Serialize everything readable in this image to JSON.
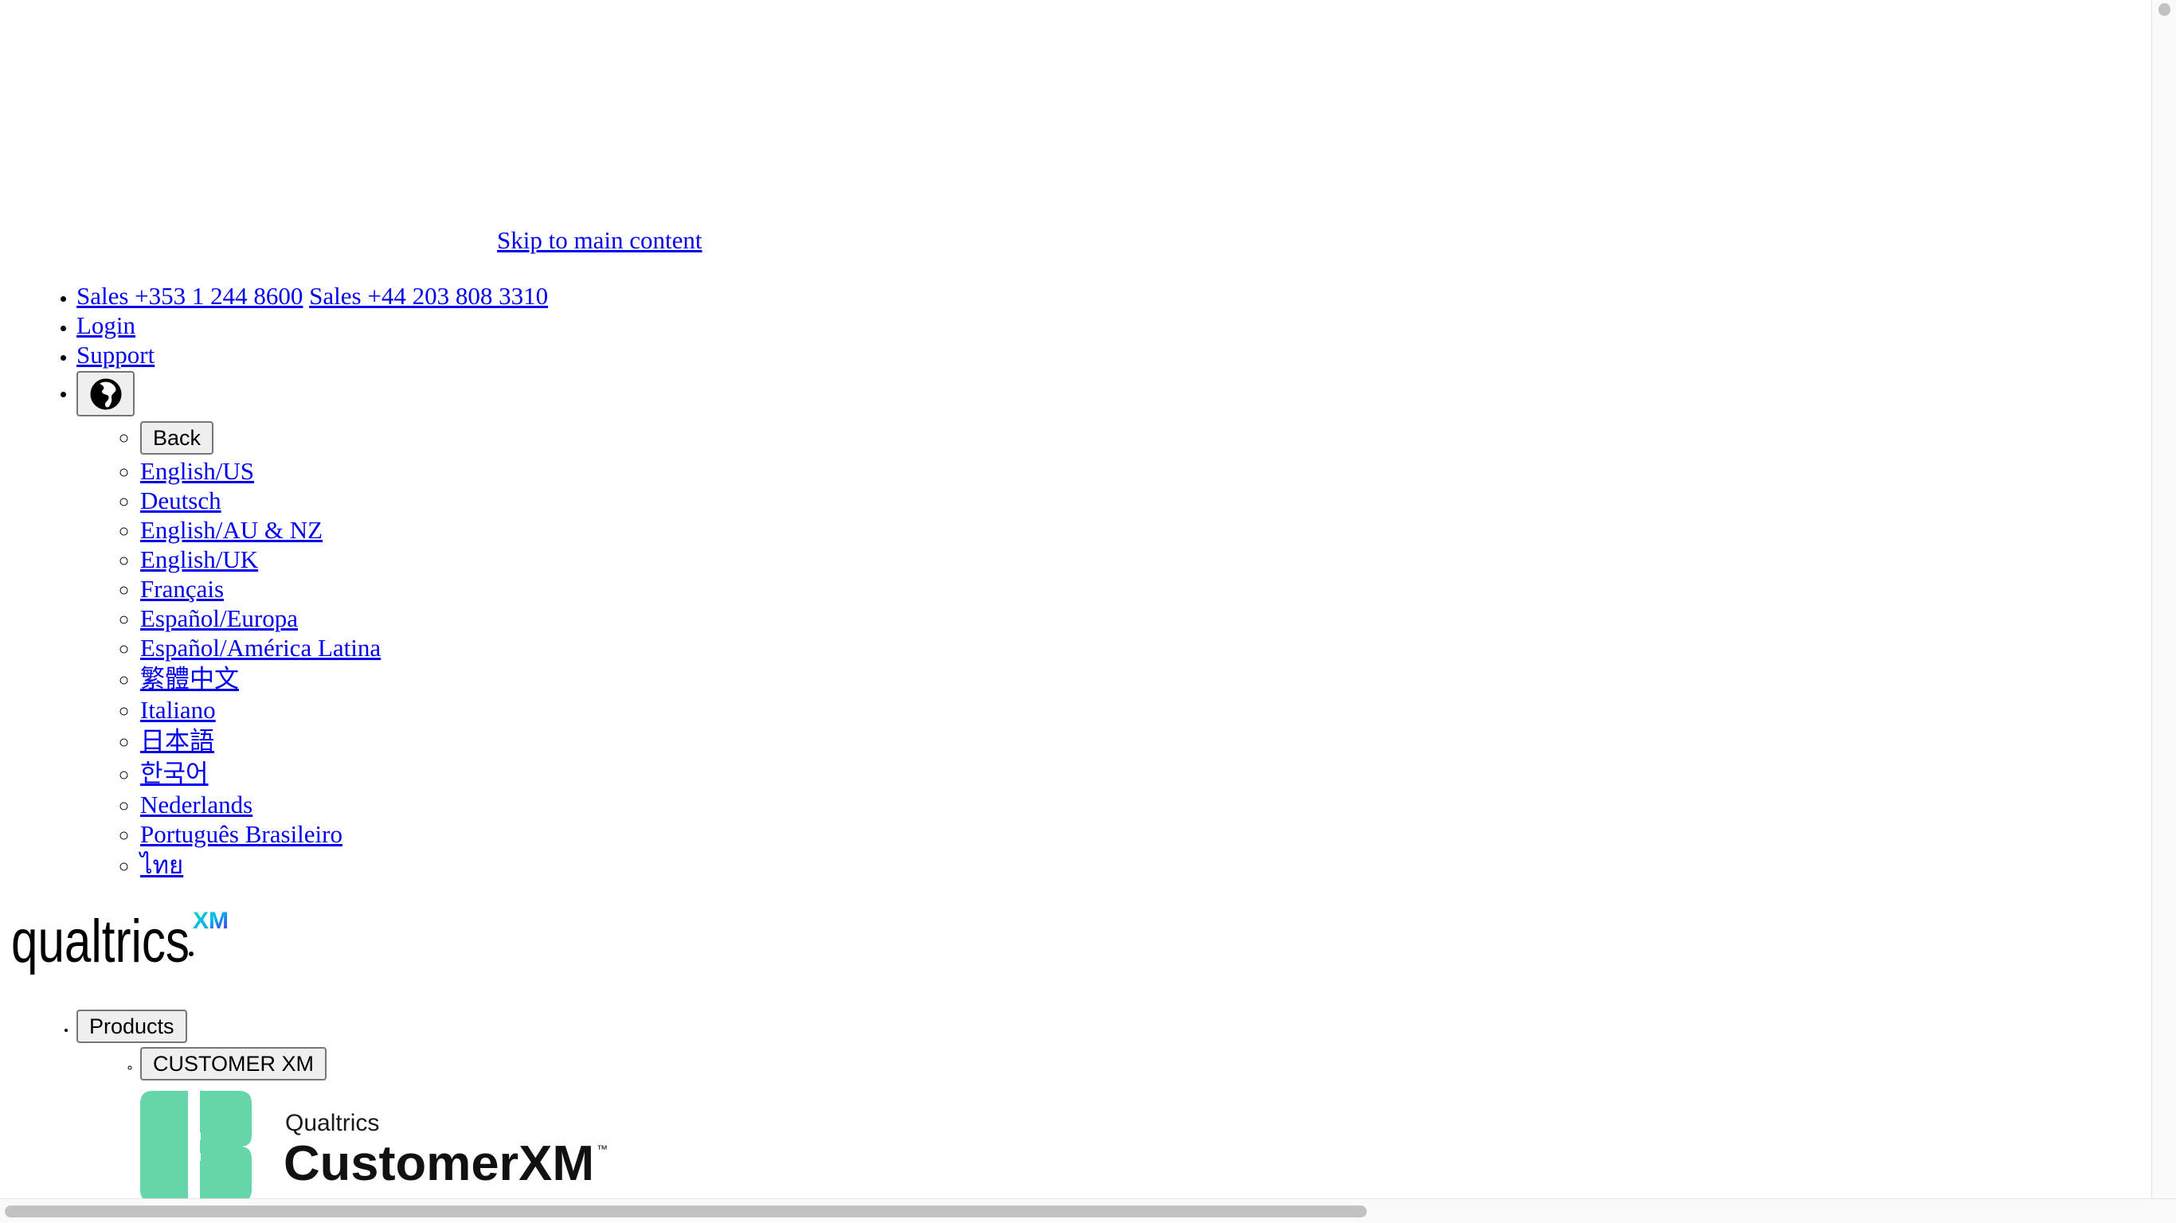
{
  "skip_link": "Skip to main content",
  "utility_nav": {
    "sales_ie": "Sales +353 1 244 8600",
    "sales_uk": "Sales +44 203 808 3310",
    "login": "Login",
    "support": "Support",
    "globe_icon": "globe-icon",
    "back_label": "Back",
    "languages": [
      "English/US",
      "Deutsch",
      "English/AU & NZ",
      "English/UK",
      "Français",
      "Español/Europa",
      "Español/América Latina",
      "繁體中文",
      "Italiano",
      "日本語",
      "한국어",
      "Nederlands",
      "Português Brasileiro",
      "ไทย"
    ]
  },
  "logo": {
    "wordmark": "qualtrics",
    "superscript": "XM"
  },
  "main_nav": {
    "products_label": "Products",
    "customer_xm_label": "CUSTOMER XM",
    "customer_xm_logo": {
      "brand": "Qualtrics",
      "product": "CustomerXM",
      "trademark": "™",
      "accent_color": "#66d6a8"
    }
  }
}
